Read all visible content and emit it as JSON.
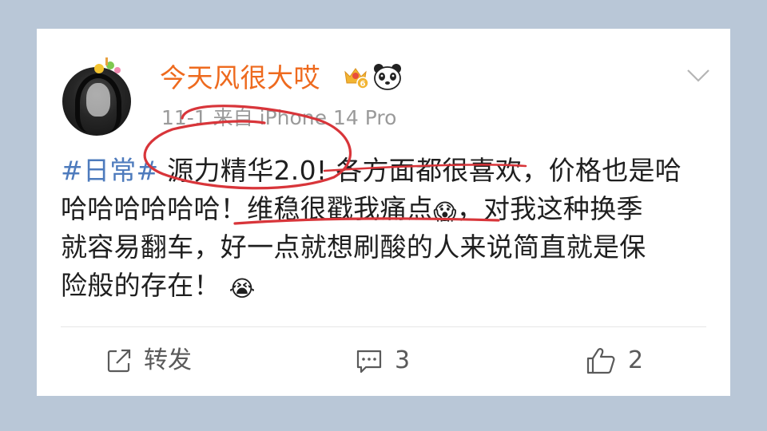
{
  "post": {
    "author": {
      "name": "今天风很大哎",
      "avatar_icon": "user-avatar",
      "badges": [
        "crown-badge-icon",
        "panda-icon"
      ],
      "crown_level": "6"
    },
    "meta": "11-1 来自 iPhone 14 Pro",
    "content": {
      "hashtag": "#日常#",
      "line1": " 源力精华2.0! 各方面都很喜欢，价格也是哈",
      "line2": "哈哈哈哈哈哈！维稳很戳我痛点",
      "line2_tail": "，对我这种换季",
      "line3": "就容易翻车，好一点就想刷酸的人来说简直就是保",
      "line4": "险般的存在！",
      "emoji_1": "😱",
      "emoji_2": "😭"
    },
    "actions": {
      "repost_label": "转发",
      "comment_count": "3",
      "like_count": "2"
    },
    "annotation_color": "#d8353a",
    "accent_color": "#ee6a1e",
    "hashtag_color": "#4e7bbd"
  }
}
